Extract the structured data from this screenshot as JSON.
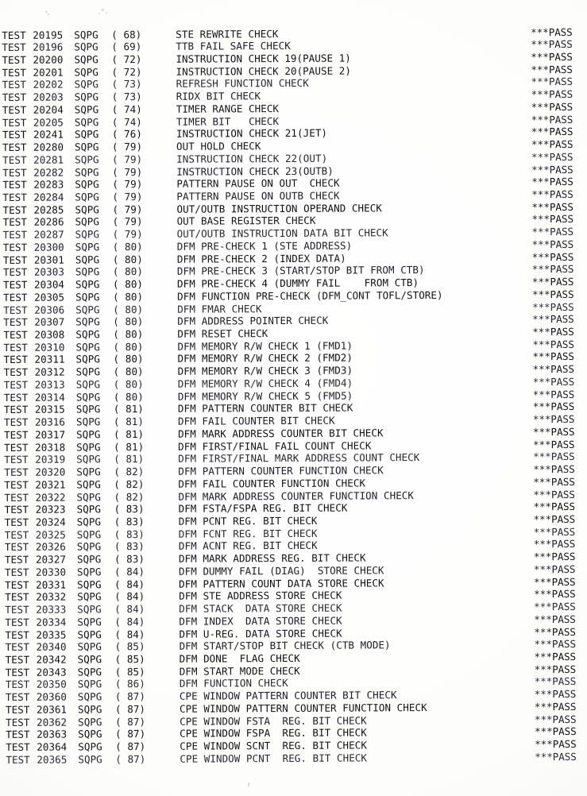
{
  "document": {
    "kind": "scanned-printout",
    "columns": {
      "test_label": "TEST",
      "program": "SQPG",
      "result": "***PASS"
    }
  },
  "rows": [
    {
      "label": "TEST",
      "number": "20195",
      "program": "SQPG",
      "group": "( 68)",
      "description": "STE REWRITE CHECK",
      "result": "***PASS"
    },
    {
      "label": "TEST",
      "number": "20196",
      "program": "SQPG",
      "group": "( 69)",
      "description": "TTB FAIL SAFE CHECK",
      "result": "***PASS"
    },
    {
      "label": "TEST",
      "number": "20200",
      "program": "SQPG",
      "group": "( 72)",
      "description": "INSTRUCTION CHECK 19(PAUSE 1)",
      "result": "***PASS"
    },
    {
      "label": "TEST",
      "number": "20201",
      "program": "SQPG",
      "group": "( 72)",
      "description": "INSTRUCTION CHECK 20(PAUSE 2)",
      "result": "***PASS"
    },
    {
      "label": "TEST",
      "number": "20202",
      "program": "SQPG",
      "group": "( 73)",
      "description": "REFRESH FUNCTION CHECK",
      "result": "***PASS"
    },
    {
      "label": "TEST",
      "number": "20203",
      "program": "SQPG",
      "group": "( 73)",
      "description": "RIDX BIT CHECK",
      "result": "***PASS"
    },
    {
      "label": "TEST",
      "number": "20204",
      "program": "SQPG",
      "group": "( 74)",
      "description": "TIMER RANGE CHECK",
      "result": "***PASS"
    },
    {
      "label": "TEST",
      "number": "20205",
      "program": "SQPG",
      "group": "( 74)",
      "description": "TIMER BIT   CHECK",
      "result": "***PASS"
    },
    {
      "label": "TEST",
      "number": "20241",
      "program": "SQPG",
      "group": "( 76)",
      "description": "INSTRUCTION CHECK 21(JET)",
      "result": "***PASS"
    },
    {
      "label": "TEST",
      "number": "20280",
      "program": "SQPG",
      "group": "( 79)",
      "description": "OUT HOLD CHECK",
      "result": "***PASS"
    },
    {
      "label": "TEST",
      "number": "20281",
      "program": "SQPG",
      "group": "( 79)",
      "description": "INSTRUCTION CHECK 22(OUT)",
      "result": "***PASS"
    },
    {
      "label": "TEST",
      "number": "20282",
      "program": "SQPG",
      "group": "( 79)",
      "description": "INSTRUCTION CHECK 23(OUTB)",
      "result": "***PASS"
    },
    {
      "label": "TEST",
      "number": "20283",
      "program": "SQPG",
      "group": "( 79)",
      "description": "PATTERN PAUSE ON OUT  CHECK",
      "result": "***PASS"
    },
    {
      "label": "TEST",
      "number": "20284",
      "program": "SQPG",
      "group": "( 79)",
      "description": "PATTERN PAUSE ON OUTB CHECK",
      "result": "***PASS"
    },
    {
      "label": "TEST",
      "number": "20285",
      "program": "SQPG",
      "group": "( 79)",
      "description": "OUT/OUTB INSTRUCTION OPERAND CHECK",
      "result": "***PASS"
    },
    {
      "label": "TEST",
      "number": "20286",
      "program": "SQPG",
      "group": "( 79)",
      "description": "OUT BASE REGISTER CHECK",
      "result": "***PASS"
    },
    {
      "label": "TEST",
      "number": "20287",
      "program": "SQPG",
      "group": "( 79)",
      "description": "OUT/OUTB INSTRUCTION DATA BIT CHECK",
      "result": "***PASS"
    },
    {
      "label": "TEST",
      "number": "20300",
      "program": "SQPG",
      "group": "( 80)",
      "description": "DFM PRE-CHECK 1 (STE ADDRESS)",
      "result": "***PASS"
    },
    {
      "label": "TEST",
      "number": "20301",
      "program": "SQPG",
      "group": "( 80)",
      "description": "DFM PRE-CHECK 2 (INDEX DATA)",
      "result": "***PASS"
    },
    {
      "label": "TEST",
      "number": "20303",
      "program": "SQPG",
      "group": "( 80)",
      "description": "DFM PRE-CHECK 3 (START/STOP BIT FROM CTB)",
      "result": "***PASS"
    },
    {
      "label": "TEST",
      "number": "20304",
      "program": "SQPG",
      "group": "( 80)",
      "description": "DFM PRE-CHECK 4 (DUMMY FAIL    FROM CTB)",
      "result": "***PASS"
    },
    {
      "label": "TEST",
      "number": "20305",
      "program": "SQPG",
      "group": "( 80)",
      "description": "DFM FUNCTION PRE-CHECK (DFM_CONT TOFL/STORE)",
      "result": "***PASS"
    },
    {
      "label": "TEST",
      "number": "20306",
      "program": "SQPG",
      "group": "( 80)",
      "description": "DFM FMAR CHECK",
      "result": "***PASS"
    },
    {
      "label": "TEST",
      "number": "20307",
      "program": "SQPG",
      "group": "( 80)",
      "description": "DFM ADDRESS POINTER CHECK",
      "result": "***PASS"
    },
    {
      "label": "TEST",
      "number": "20308",
      "program": "SQPG",
      "group": "( 80)",
      "description": "DFM RESET CHECK",
      "result": "***PASS"
    },
    {
      "label": "TEST",
      "number": "20310",
      "program": "SQPG",
      "group": "( 80)",
      "description": "DFM MEMORY R/W CHECK 1 (FMD1)",
      "result": "***PASS"
    },
    {
      "label": "TEST",
      "number": "20311",
      "program": "SQPG",
      "group": "( 80)",
      "description": "DFM MEMORY R/W CHECK 2 (FMD2)",
      "result": "***PASS"
    },
    {
      "label": "TEST",
      "number": "20312",
      "program": "SQPG",
      "group": "( 80)",
      "description": "DFM MEMORY R/W CHECK 3 (FMD3)",
      "result": "***PASS"
    },
    {
      "label": "TEST",
      "number": "20313",
      "program": "SQPG",
      "group": "( 80)",
      "description": "DFM MEMORY R/W CHECK 4 (FMD4)",
      "result": "***PASS"
    },
    {
      "label": "TEST",
      "number": "20314",
      "program": "SQPG",
      "group": "( 80)",
      "description": "DFM MEMORY R/W CHECK 5 (FMD5)",
      "result": "***PASS"
    },
    {
      "label": "TEST",
      "number": "20315",
      "program": "SQPG",
      "group": "( 81)",
      "description": "DFM PATTERN COUNTER BIT CHECK",
      "result": "***PASS"
    },
    {
      "label": "TEST",
      "number": "20316",
      "program": "SQPG",
      "group": "( 81)",
      "description": "DFM FAIL COUNTER BIT CHECK",
      "result": "***PASS"
    },
    {
      "label": "TEST",
      "number": "20317",
      "program": "SQPG",
      "group": "( 81)",
      "description": "DFM MARK ADDRESS COUNTER BIT CHECK",
      "result": "***PASS"
    },
    {
      "label": "TEST",
      "number": "20318",
      "program": "SQPG",
      "group": "( 81)",
      "description": "DFM FIRST/FINAL FAIL COUNT CHECK",
      "result": "***PASS"
    },
    {
      "label": "TEST",
      "number": "20319",
      "program": "SQPG",
      "group": "( 81)",
      "description": "DFM FIRST/FINAL MARK ADDRESS COUNT CHECK",
      "result": "***PASS"
    },
    {
      "label": "TEST",
      "number": "20320",
      "program": "SQPG",
      "group": "( 82)",
      "description": "DFM PATTERN COUNTER FUNCTION CHECK",
      "result": "***PASS"
    },
    {
      "label": "TEST",
      "number": "20321",
      "program": "SQPG",
      "group": "( 82)",
      "description": "DFM FAIL COUNTER FUNCTION CHECK",
      "result": "***PASS"
    },
    {
      "label": "TEST",
      "number": "20322",
      "program": "SQPG",
      "group": "( 82)",
      "description": "DFM MARK ADDRESS COUNTER FUNCTION CHECK",
      "result": "***PASS"
    },
    {
      "label": "TEST",
      "number": "20323",
      "program": "SQPG",
      "group": "( 83)",
      "description": "DFM FSTA/FSPA REG. BIT CHECK",
      "result": "***PASS"
    },
    {
      "label": "TEST",
      "number": "20324",
      "program": "SQPG",
      "group": "( 83)",
      "description": "DFM PCNT REG. BIT CHECK",
      "result": "***PASS"
    },
    {
      "label": "TEST",
      "number": "20325",
      "program": "SQPG",
      "group": "( 83)",
      "description": "DFM FCNT REG. BIT CHECK",
      "result": "***PASS"
    },
    {
      "label": "TEST",
      "number": "20326",
      "program": "SQPG",
      "group": "( 83)",
      "description": "DFM ACNT REG. BIT CHECK",
      "result": "***PASS"
    },
    {
      "label": "TEST",
      "number": "20327",
      "program": "SQPG",
      "group": "( 83)",
      "description": "DFM MARK ADDRESS REG. BIT CHECK",
      "result": "***PASS"
    },
    {
      "label": "TEST",
      "number": "20330",
      "program": "SQPG",
      "group": "( 84)",
      "description": "DFM DUMMY FAIL (DIAG)  STORE CHECK",
      "result": "***PASS"
    },
    {
      "label": "TEST",
      "number": "20331",
      "program": "SQPG",
      "group": "( 84)",
      "description": "DFM PATTERN COUNT DATA STORE CHECK",
      "result": "***PASS"
    },
    {
      "label": "TEST",
      "number": "20332",
      "program": "SQPG",
      "group": "( 84)",
      "description": "DFM STE ADDRESS STORE CHECK",
      "result": "***PASS"
    },
    {
      "label": "TEST",
      "number": "20333",
      "program": "SQPG",
      "group": "( 84)",
      "description": "DFM STACK  DATA STORE CHECK",
      "result": "***PASS"
    },
    {
      "label": "TEST",
      "number": "20334",
      "program": "SQPG",
      "group": "( 84)",
      "description": "DFM INDEX  DATA STORE CHECK",
      "result": "***PASS"
    },
    {
      "label": "TEST",
      "number": "20335",
      "program": "SQPG",
      "group": "( 84)",
      "description": "DFM U-REG. DATA STORE CHECK",
      "result": "***PASS"
    },
    {
      "label": "TEST",
      "number": "20340",
      "program": "SQPG",
      "group": "( 85)",
      "description": "DFM START/STOP BIT CHECK (CTB MODE)",
      "result": "***PASS"
    },
    {
      "label": "TEST",
      "number": "20342",
      "program": "SQPG",
      "group": "( 85)",
      "description": "DFM DONE  FLAG CHECK",
      "result": "***PASS"
    },
    {
      "label": "TEST",
      "number": "20343",
      "program": "SQPG",
      "group": "( 85)",
      "description": "DFM START MODE CHECK",
      "result": "***PASS"
    },
    {
      "label": "TEST",
      "number": "20350",
      "program": "SQPG",
      "group": "( 86)",
      "description": "DFM FUNCTION CHECK",
      "result": "***PASS"
    },
    {
      "label": "TEST",
      "number": "20360",
      "program": "SQPG",
      "group": "( 87)",
      "description": "CPE WINDOW PATTERN COUNTER BIT CHECK",
      "result": "***PASS"
    },
    {
      "label": "TEST",
      "number": "20361",
      "program": "SQPG",
      "group": "( 87)",
      "description": "CPE WINDOW PATTERN COUNTER FUNCTION CHECK",
      "result": "***PASS"
    },
    {
      "label": "TEST",
      "number": "20362",
      "program": "SQPG",
      "group": "( 87)",
      "description": "CPE WINDOW FSTA  REG. BIT CHECK",
      "result": "***PASS"
    },
    {
      "label": "TEST",
      "number": "20363",
      "program": "SQPG",
      "group": "( 87)",
      "description": "CPE WINDOW FSPA  REG. BIT CHECK",
      "result": "***PASS"
    },
    {
      "label": "TEST",
      "number": "20364",
      "program": "SQPG",
      "group": "( 87)",
      "description": "CPE WINDOW SCNT  REG. BIT CHECK",
      "result": "***PASS"
    },
    {
      "label": "TEST",
      "number": "20365",
      "program": "SQPG",
      "group": "( 87)",
      "description": "CPE WINDOW PCNT  REG. BIT CHECK",
      "result": "***PASS"
    }
  ]
}
